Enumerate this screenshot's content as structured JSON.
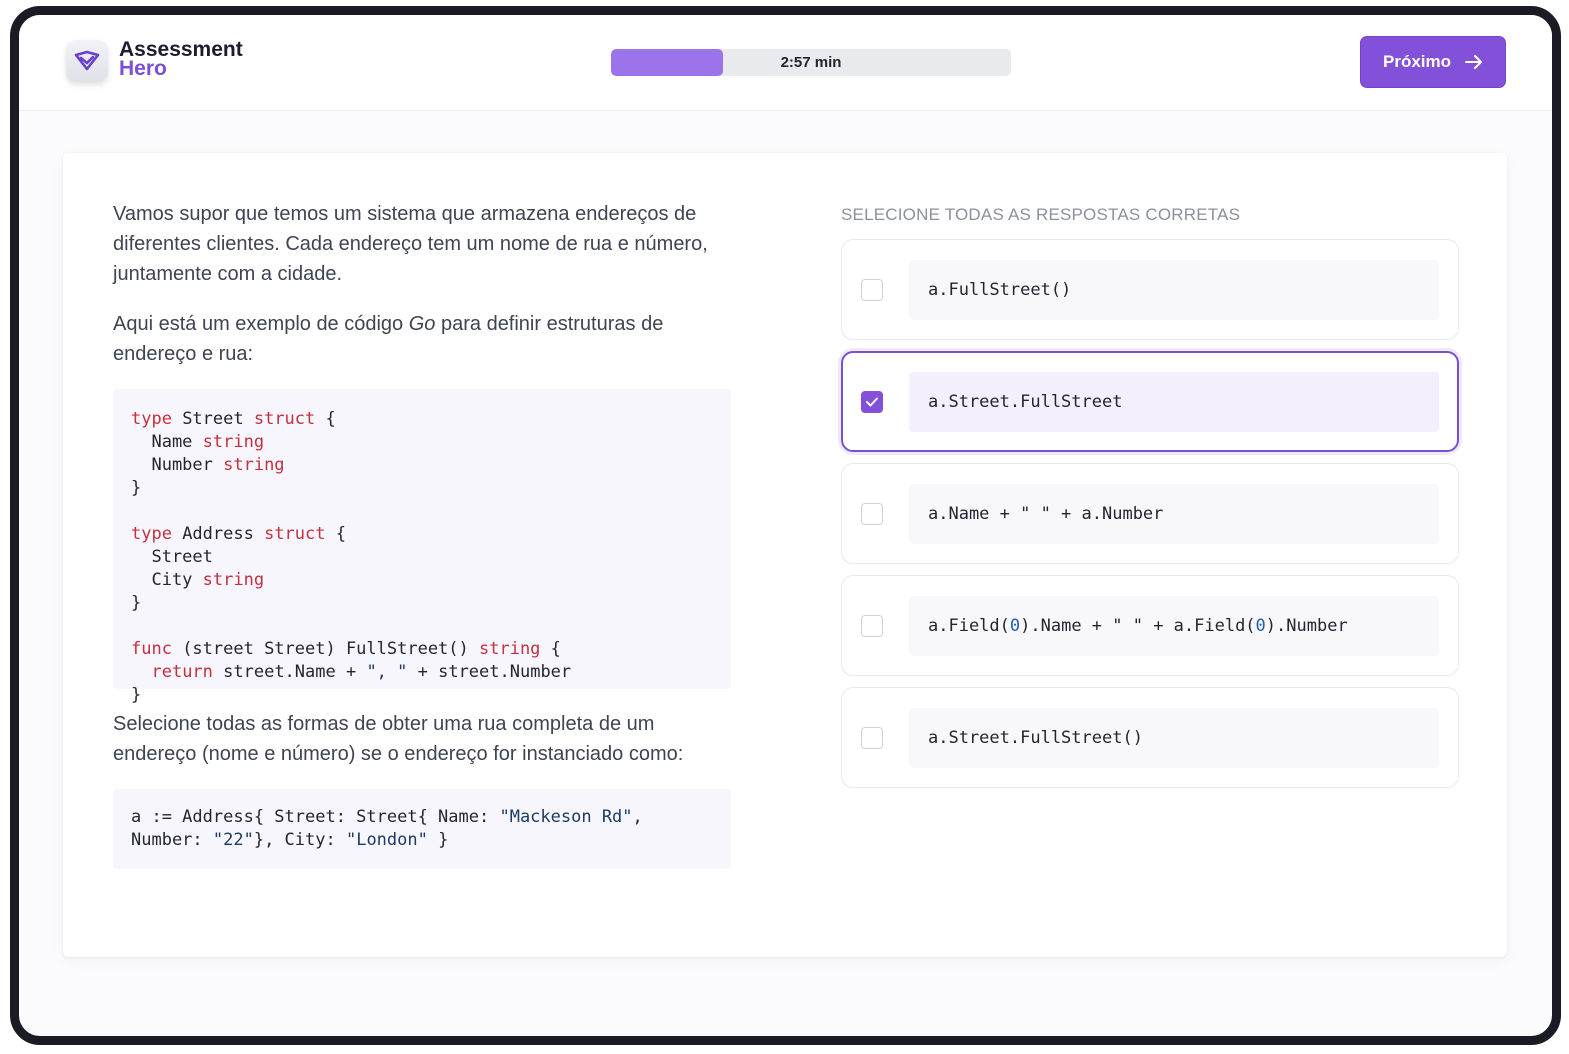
{
  "header": {
    "logo_line1": "Assessment",
    "logo_line2": "Hero",
    "timer_text": "2:57 min",
    "progress_fraction": 0.28,
    "next_label": "Próximo"
  },
  "question": {
    "paragraph1": "Vamos supor que temos um sistema que armazena endereços de diferentes clientes. Cada endereço tem um nome de rua e número, juntamente com a cidade.",
    "paragraph2_before": "Aqui está um exemplo de código ",
    "paragraph2_em": "Go",
    "paragraph2_after": " para definir estruturas de endereço e rua:",
    "paragraph3": "Selecione todas as formas de obter uma rua completa de um endereço (nome e número) se o endereço for instanciado como:"
  },
  "answers": {
    "instructions": "SELECIONE TODAS AS RESPOSTAS CORRETAS",
    "options": [
      {
        "code": "a.FullStreet()",
        "selected": false
      },
      {
        "code": "a.Street.FullStreet",
        "selected": true
      },
      {
        "code": "a.Name + \" \" + a.Number",
        "selected": false
      },
      {
        "code": "a.Field(0).Name + \" \" + a.Field(0).Number",
        "selected": false
      },
      {
        "code": "a.Street.FullStreet()",
        "selected": false
      }
    ]
  },
  "colors": {
    "accent": "#8351d9",
    "progress_fill": "#9b73ea",
    "keyword": "#c5303f",
    "selected_bg": "#f5eefc"
  }
}
